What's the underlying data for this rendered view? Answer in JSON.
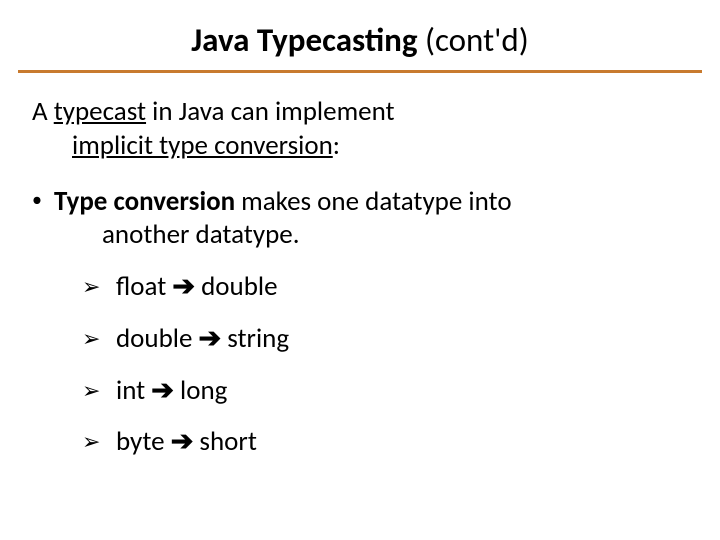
{
  "title": {
    "bold": "Java Typecasting",
    "normal": " (cont'd)"
  },
  "intro": {
    "a": "A ",
    "typecast": "typecast",
    "mid": " in Java can implement",
    "implicit": "implicit type conversion",
    "colon": ":"
  },
  "bullet1": {
    "bold": "Type conversion",
    "rest": " makes one datatype into",
    "line2": "another datatype."
  },
  "arrows": {
    "marker": "➢",
    "sep": "➔",
    "items": [
      {
        "from": "float",
        "to": "double",
        "pad": " "
      },
      {
        "from": "double",
        "to": "string",
        "pad": " "
      },
      {
        "from": "int",
        "to": "long",
        "pad": "  "
      },
      {
        "from": "byte",
        "to": "short",
        "pad": " "
      }
    ]
  }
}
